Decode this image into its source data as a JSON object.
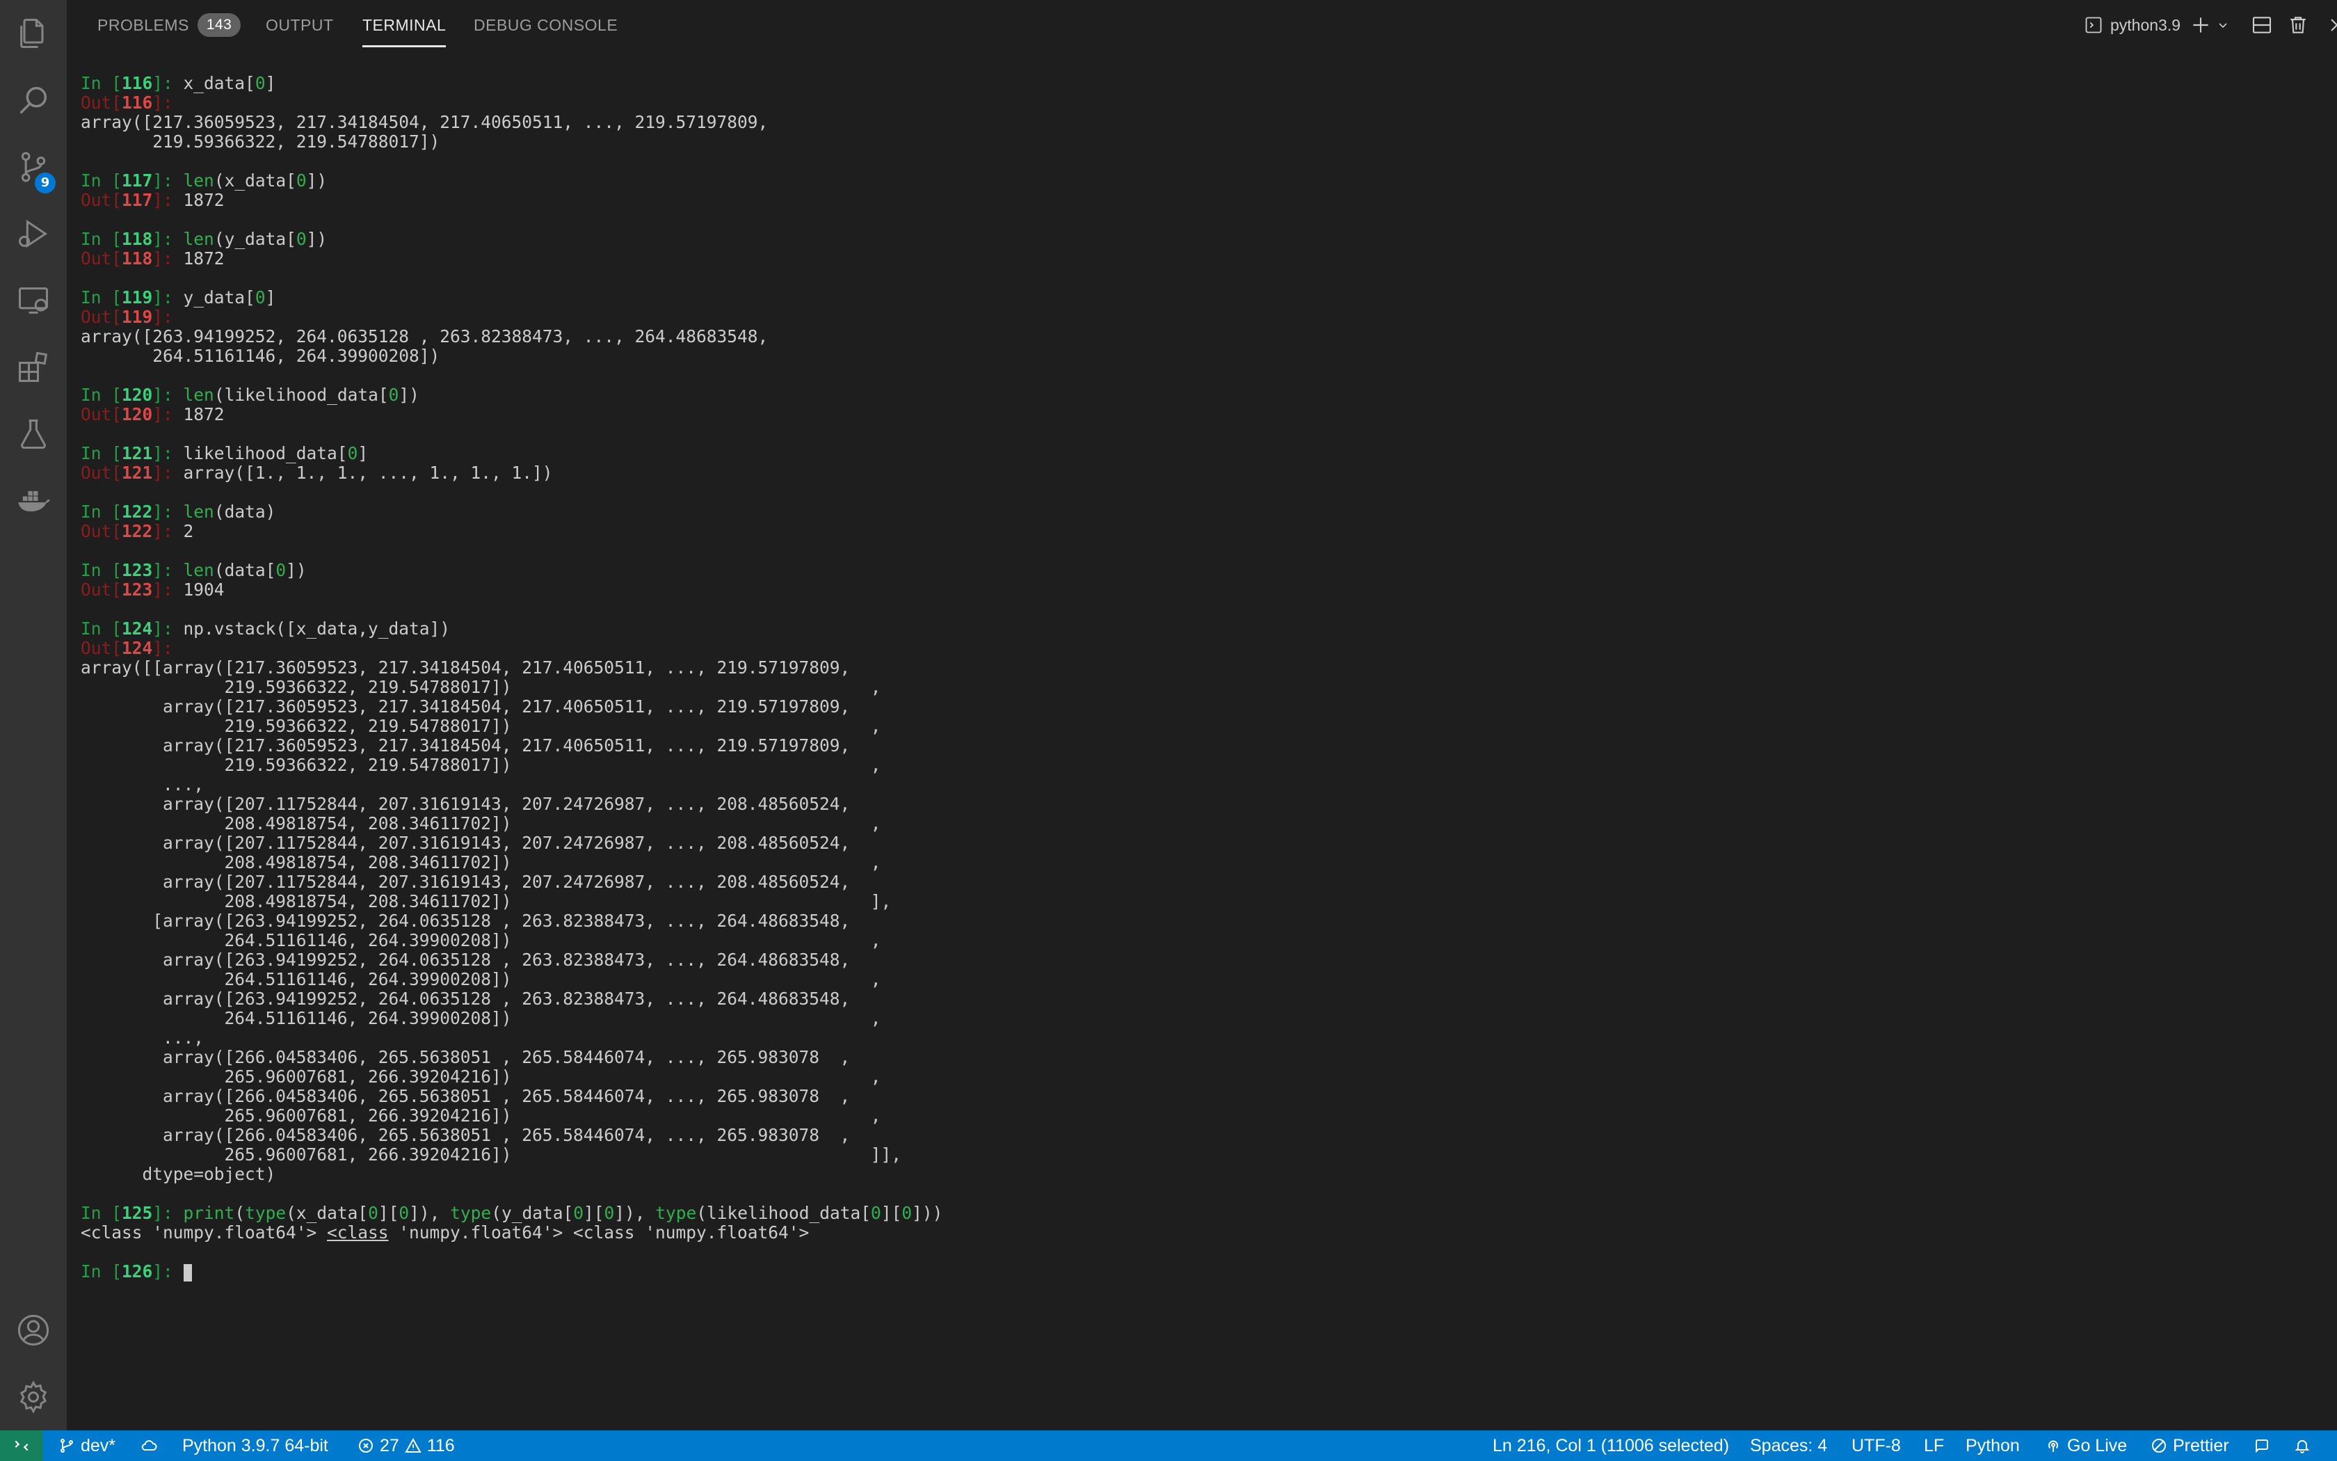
{
  "activity_bar": {
    "scm_badge": "9",
    "icons": [
      "files-icon",
      "search-icon",
      "source-control-icon",
      "run-debug-icon",
      "remote-explorer-icon",
      "extensions-icon",
      "testing-icon",
      "docker-icon",
      "account-icon",
      "settings-gear-icon"
    ]
  },
  "panel": {
    "tabs": [
      {
        "label": "PROBLEMS",
        "badge": "143"
      },
      {
        "label": "OUTPUT"
      },
      {
        "label": "TERMINAL"
      },
      {
        "label": "DEBUG CONSOLE"
      }
    ],
    "active_tab": "TERMINAL",
    "terminal_name": "python3.9",
    "header_icons": [
      "terminal-icon",
      "new-terminal-icon",
      "launch-profile-chevron-icon",
      "split-terminal-icon",
      "kill-terminal-icon",
      "maximize-panel-icon",
      "close-panel-icon"
    ]
  },
  "terminal": {
    "lines": [
      [
        {
          "t": "In [",
          "c": "inp"
        },
        {
          "t": "116",
          "c": "inpnum"
        },
        {
          "t": "]: ",
          "c": "inp"
        },
        {
          "t": "x_data["
        },
        {
          "t": "0",
          "c": "hl"
        },
        {
          "t": "]"
        }
      ],
      [
        {
          "t": "Out[",
          "c": "out"
        },
        {
          "t": "116",
          "c": "outnum"
        },
        {
          "t": "]:",
          "c": "out"
        }
      ],
      [
        {
          "t": "array([217.36059523, 217.34184504, 217.40650511, ..., 219.57197809,"
        }
      ],
      [
        {
          "t": "       219.59366322, 219.54788017])"
        }
      ],
      [],
      [
        {
          "t": "In [",
          "c": "inp"
        },
        {
          "t": "117",
          "c": "inpnum"
        },
        {
          "t": "]: ",
          "c": "inp"
        },
        {
          "t": "len",
          "c": "hl"
        },
        {
          "t": "(x_data["
        },
        {
          "t": "0",
          "c": "hl"
        },
        {
          "t": "])"
        }
      ],
      [
        {
          "t": "Out[",
          "c": "out"
        },
        {
          "t": "117",
          "c": "outnum"
        },
        {
          "t": "]: ",
          "c": "out"
        },
        {
          "t": "1872"
        }
      ],
      [],
      [
        {
          "t": "In [",
          "c": "inp"
        },
        {
          "t": "118",
          "c": "inpnum"
        },
        {
          "t": "]: ",
          "c": "inp"
        },
        {
          "t": "len",
          "c": "hl"
        },
        {
          "t": "(y_data["
        },
        {
          "t": "0",
          "c": "hl"
        },
        {
          "t": "])"
        }
      ],
      [
        {
          "t": "Out[",
          "c": "out"
        },
        {
          "t": "118",
          "c": "outnum"
        },
        {
          "t": "]: ",
          "c": "out"
        },
        {
          "t": "1872"
        }
      ],
      [],
      [
        {
          "t": "In [",
          "c": "inp"
        },
        {
          "t": "119",
          "c": "inpnum"
        },
        {
          "t": "]: ",
          "c": "inp"
        },
        {
          "t": "y_data["
        },
        {
          "t": "0",
          "c": "hl"
        },
        {
          "t": "]"
        }
      ],
      [
        {
          "t": "Out[",
          "c": "out"
        },
        {
          "t": "119",
          "c": "outnum"
        },
        {
          "t": "]:",
          "c": "out"
        }
      ],
      [
        {
          "t": "array([263.94199252, 264.0635128 , 263.82388473, ..., 264.48683548,"
        }
      ],
      [
        {
          "t": "       264.51161146, 264.39900208])"
        }
      ],
      [],
      [
        {
          "t": "In [",
          "c": "inp"
        },
        {
          "t": "120",
          "c": "inpnum"
        },
        {
          "t": "]: ",
          "c": "inp"
        },
        {
          "t": "len",
          "c": "hl"
        },
        {
          "t": "(likelihood_data["
        },
        {
          "t": "0",
          "c": "hl"
        },
        {
          "t": "])"
        }
      ],
      [
        {
          "t": "Out[",
          "c": "out"
        },
        {
          "t": "120",
          "c": "outnum"
        },
        {
          "t": "]: ",
          "c": "out"
        },
        {
          "t": "1872"
        }
      ],
      [],
      [
        {
          "t": "In [",
          "c": "inp"
        },
        {
          "t": "121",
          "c": "inpnum"
        },
        {
          "t": "]: ",
          "c": "inp"
        },
        {
          "t": "likelihood_data["
        },
        {
          "t": "0",
          "c": "hl"
        },
        {
          "t": "]"
        }
      ],
      [
        {
          "t": "Out[",
          "c": "out"
        },
        {
          "t": "121",
          "c": "outnum"
        },
        {
          "t": "]: ",
          "c": "out"
        },
        {
          "t": "array([1., 1., 1., ..., 1., 1., 1.])"
        }
      ],
      [],
      [
        {
          "t": "In [",
          "c": "inp"
        },
        {
          "t": "122",
          "c": "inpnum"
        },
        {
          "t": "]: ",
          "c": "inp"
        },
        {
          "t": "len",
          "c": "hl"
        },
        {
          "t": "(data)"
        }
      ],
      [
        {
          "t": "Out[",
          "c": "out"
        },
        {
          "t": "122",
          "c": "outnum"
        },
        {
          "t": "]: ",
          "c": "out"
        },
        {
          "t": "2"
        }
      ],
      [],
      [
        {
          "t": "In [",
          "c": "inp"
        },
        {
          "t": "123",
          "c": "inpnum"
        },
        {
          "t": "]: ",
          "c": "inp"
        },
        {
          "t": "len",
          "c": "hl"
        },
        {
          "t": "(data["
        },
        {
          "t": "0",
          "c": "hl"
        },
        {
          "t": "])"
        }
      ],
      [
        {
          "t": "Out[",
          "c": "out"
        },
        {
          "t": "123",
          "c": "outnum"
        },
        {
          "t": "]: ",
          "c": "out"
        },
        {
          "t": "1904"
        }
      ],
      [],
      [
        {
          "t": "In [",
          "c": "inp"
        },
        {
          "t": "124",
          "c": "inpnum"
        },
        {
          "t": "]: ",
          "c": "inp"
        },
        {
          "t": "np.vstack([x_data,y_data])"
        }
      ],
      [
        {
          "t": "Out[",
          "c": "out"
        },
        {
          "t": "124",
          "c": "outnum"
        },
        {
          "t": "]:",
          "c": "out"
        }
      ],
      [
        {
          "t": "array([[array([217.36059523, 217.34184504, 217.40650511, ..., 219.57197809,"
        }
      ],
      [
        {
          "t": "              219.59366322, 219.54788017])                                   ,"
        }
      ],
      [
        {
          "t": "        array([217.36059523, 217.34184504, 217.40650511, ..., 219.57197809,"
        }
      ],
      [
        {
          "t": "              219.59366322, 219.54788017])                                   ,"
        }
      ],
      [
        {
          "t": "        array([217.36059523, 217.34184504, 217.40650511, ..., 219.57197809,"
        }
      ],
      [
        {
          "t": "              219.59366322, 219.54788017])                                   ,"
        }
      ],
      [
        {
          "t": "        ...,"
        }
      ],
      [
        {
          "t": "        array([207.11752844, 207.31619143, 207.24726987, ..., 208.48560524,"
        }
      ],
      [
        {
          "t": "              208.49818754, 208.34611702])                                   ,"
        }
      ],
      [
        {
          "t": "        array([207.11752844, 207.31619143, 207.24726987, ..., 208.48560524,"
        }
      ],
      [
        {
          "t": "              208.49818754, 208.34611702])                                   ,"
        }
      ],
      [
        {
          "t": "        array([207.11752844, 207.31619143, 207.24726987, ..., 208.48560524,"
        }
      ],
      [
        {
          "t": "              208.49818754, 208.34611702])                                   ],"
        }
      ],
      [
        {
          "t": "       [array([263.94199252, 264.0635128 , 263.82388473, ..., 264.48683548,"
        }
      ],
      [
        {
          "t": "              264.51161146, 264.39900208])                                   ,"
        }
      ],
      [
        {
          "t": "        array([263.94199252, 264.0635128 , 263.82388473, ..., 264.48683548,"
        }
      ],
      [
        {
          "t": "              264.51161146, 264.39900208])                                   ,"
        }
      ],
      [
        {
          "t": "        array([263.94199252, 264.0635128 , 263.82388473, ..., 264.48683548,"
        }
      ],
      [
        {
          "t": "              264.51161146, 264.39900208])                                   ,"
        }
      ],
      [
        {
          "t": "        ...,"
        }
      ],
      [
        {
          "t": "        array([266.04583406, 265.5638051 , 265.58446074, ..., 265.983078  ,"
        }
      ],
      [
        {
          "t": "              265.96007681, 266.39204216])                                   ,"
        }
      ],
      [
        {
          "t": "        array([266.04583406, 265.5638051 , 265.58446074, ..., 265.983078  ,"
        }
      ],
      [
        {
          "t": "              265.96007681, 266.39204216])                                   ,"
        }
      ],
      [
        {
          "t": "        array([266.04583406, 265.5638051 , 265.58446074, ..., 265.983078  ,"
        }
      ],
      [
        {
          "t": "              265.96007681, 266.39204216])                                   ]],"
        }
      ],
      [
        {
          "t": "      dtype=object)"
        }
      ],
      [],
      [
        {
          "t": "In [",
          "c": "inp"
        },
        {
          "t": "125",
          "c": "inpnum"
        },
        {
          "t": "]: ",
          "c": "inp"
        },
        {
          "t": "print",
          "c": "hl"
        },
        {
          "t": "("
        },
        {
          "t": "type",
          "c": "hl"
        },
        {
          "t": "(x_data["
        },
        {
          "t": "0",
          "c": "hl"
        },
        {
          "t": "]["
        },
        {
          "t": "0",
          "c": "hl"
        },
        {
          "t": "]), "
        },
        {
          "t": "type",
          "c": "hl"
        },
        {
          "t": "(y_data["
        },
        {
          "t": "0",
          "c": "hl"
        },
        {
          "t": "]["
        },
        {
          "t": "0",
          "c": "hl"
        },
        {
          "t": "]), "
        },
        {
          "t": "type",
          "c": "hl"
        },
        {
          "t": "(likelihood_data["
        },
        {
          "t": "0",
          "c": "hl"
        },
        {
          "t": "]["
        },
        {
          "t": "0",
          "c": "hl"
        },
        {
          "t": "]))"
        }
      ],
      [
        {
          "t": "<class 'numpy.float64'> "
        },
        {
          "t": "<class",
          "c": "und"
        },
        {
          "t": " 'numpy.float64'> <class 'numpy.float64'>"
        }
      ],
      [],
      [
        {
          "t": "In [",
          "c": "inp"
        },
        {
          "t": "126",
          "c": "inpnum"
        },
        {
          "t": "]: ",
          "c": "inp"
        },
        {
          "t": "",
          "c": "cursor"
        }
      ]
    ]
  },
  "status_bar": {
    "branch": "dev*",
    "interpreter": "Python 3.9.7 64-bit",
    "errors": "27",
    "warnings": "116",
    "cursor_position": "Ln 216, Col 1 (11006 selected)",
    "indentation": "Spaces: 4",
    "encoding": "UTF-8",
    "eol": "LF",
    "language": "Python",
    "go_live": "Go Live",
    "prettier": "Prettier"
  }
}
